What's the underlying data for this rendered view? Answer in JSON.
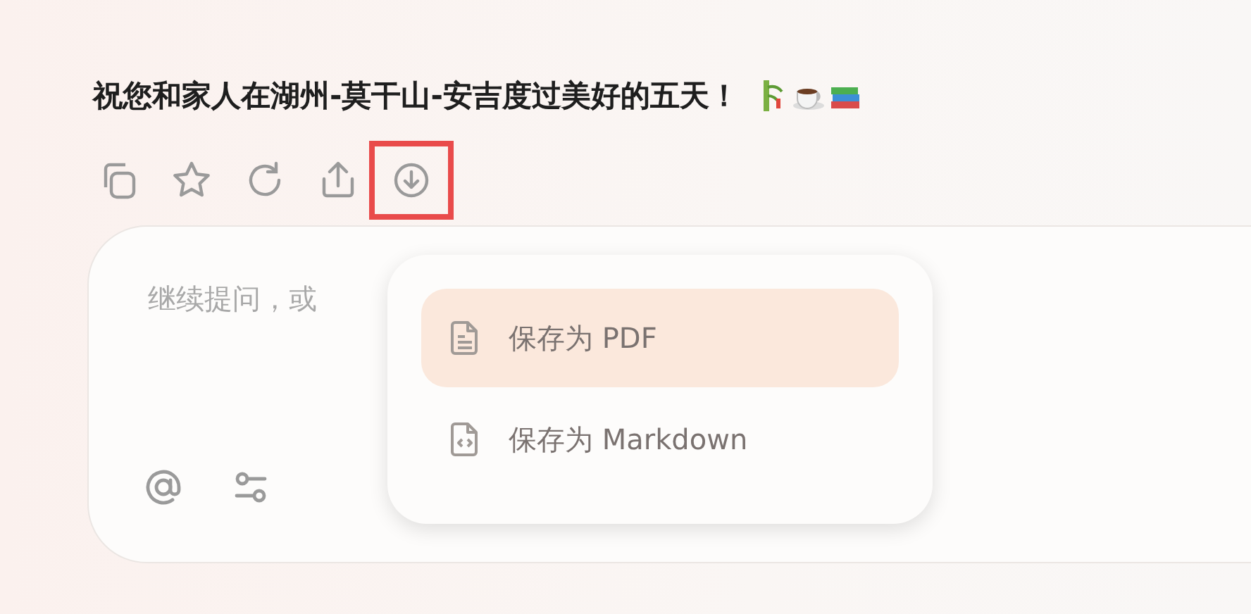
{
  "message": {
    "text": "祝您和家人在湖州-莫干山-安吉度过美好的五天！"
  },
  "actions": [
    {
      "kind": "copy",
      "highlighted": false
    },
    {
      "kind": "star",
      "highlighted": false
    },
    {
      "kind": "refresh",
      "highlighted": false
    },
    {
      "kind": "share",
      "highlighted": false
    },
    {
      "kind": "download",
      "highlighted": true
    }
  ],
  "input": {
    "placeholder": "继续提问，或"
  },
  "save_menu": [
    {
      "kind": "pdf",
      "label": "保存为 PDF",
      "selected": true
    },
    {
      "kind": "markdown",
      "label": "保存为 Markdown",
      "selected": false
    }
  ],
  "input_tools": [
    {
      "kind": "mention"
    },
    {
      "kind": "settings"
    }
  ]
}
